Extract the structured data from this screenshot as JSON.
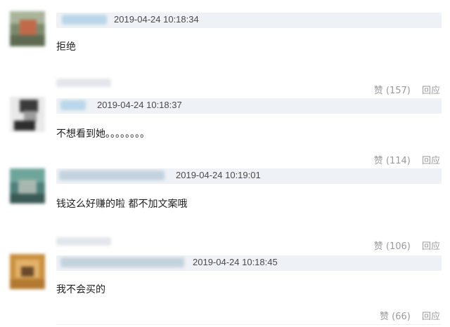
{
  "comments": [
    {
      "timestamp": "2019-04-24 10:18:34",
      "text": "拒绝",
      "likes": "赞 (157)",
      "reply": "回应"
    },
    {
      "timestamp": "2019-04-24 10:18:37",
      "text": "不想看到她。。。。。。。。",
      "likes": "赞 (114)",
      "reply": "回应"
    },
    {
      "timestamp": "2019-04-24 10:19:01",
      "text": "钱这么好赚的啦 都不加文案哦",
      "likes": "赞 (106)",
      "reply": "回应"
    },
    {
      "timestamp": "2019-04-24 10:18:45",
      "text": "我不会买的",
      "likes": "赞 (66)",
      "reply": "回应"
    }
  ]
}
